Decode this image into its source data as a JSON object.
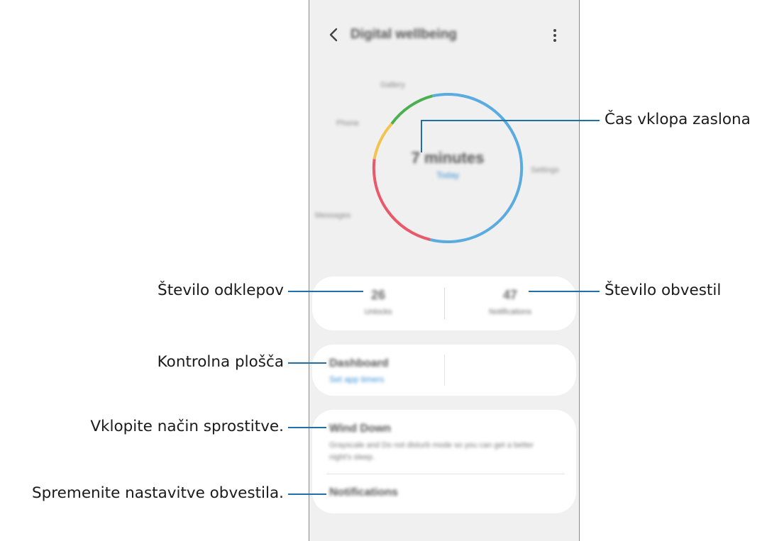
{
  "app": {
    "title": "Digital wellbeing",
    "back_icon": "back-arrow-icon",
    "more_icon": "more-vert-icon"
  },
  "chart": {
    "screen_time_value": "7 minutes",
    "screen_time_sub": "Today",
    "segment_labels": [
      "Gallery",
      "Phone",
      "Settings",
      "Messages"
    ],
    "segments": [
      {
        "app": "Gallery",
        "color": "#4caf50"
      },
      {
        "app": "Settings",
        "color": "#5aabe0"
      },
      {
        "app": "Messages",
        "color": "#e85a6a"
      },
      {
        "app": "Phone",
        "color": "#f2c44e"
      }
    ]
  },
  "stats": {
    "unlocks_value": "26",
    "unlocks_label": "Unlocks",
    "notifications_value": "47",
    "notifications_label": "Notifications"
  },
  "dashboard": {
    "title": "Dashboard",
    "subtitle": "Set app timers"
  },
  "wind_down": {
    "title": "Wind Down",
    "description": "Grayscale and Do not disturb mode so you can get a better night's sleep."
  },
  "notifications": {
    "title": "Notifications"
  },
  "callouts": {
    "screen_time": "Čas vklopa zaslona",
    "unlocks": "Število odklepov",
    "notifications_count": "Število obvestil",
    "dashboard": "Kontrolna plošča",
    "wind_down": "Vklopite način sprostitve.",
    "notification_settings": "Spremenite nastavitve obvestila."
  },
  "colors": {
    "callout_line": "#1f6fa8",
    "phone_bg": "#f0f0f0",
    "accent": "#3b8fd6"
  }
}
